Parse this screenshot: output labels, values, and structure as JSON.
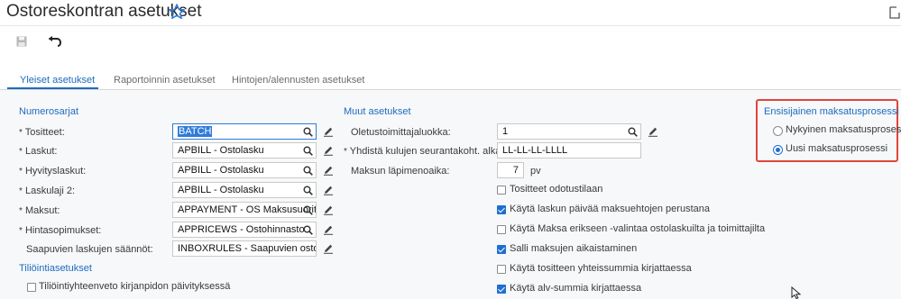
{
  "header": {
    "title": "Ostoreskontran asetukset"
  },
  "tabs": [
    {
      "label": "Yleiset asetukset"
    },
    {
      "label": "Raportoinnin asetukset"
    },
    {
      "label": "Hintojen/alennusten asetukset"
    }
  ],
  "numerosarjat": {
    "heading": "Numerosarjat",
    "required_mark": "*",
    "rows": [
      {
        "label": "Tositteet:",
        "value_selected": "BATCH"
      },
      {
        "label": "Laskut:",
        "value": "APBILL - Ostolasku"
      },
      {
        "label": "Hyvityslaskut:",
        "value": "APBILL - Ostolasku"
      },
      {
        "label": "Laskulaji 2:",
        "value": "APBILL - Ostolasku"
      },
      {
        "label": "Maksut:",
        "value": "APPAYMENT - OS Maksusuoritu"
      },
      {
        "label": "Hintasopimukset:",
        "value": "APPRICEWS - Ostohinnasto"
      },
      {
        "label": "Saapuvien laskujen säännöt:",
        "value": "INBOXRULES - Saapuvien osto"
      }
    ]
  },
  "tiliointi": {
    "heading": "Tiliöintiasetukset",
    "checkbox_label": "Tiliöintiyhteenveto kirjanpidon päivityksessä",
    "checked": false
  },
  "muut": {
    "heading": "Muut asetukset",
    "oletustoimittaja_label": "Oletustoimittajaluokka:",
    "oletustoimittaja_value": "1",
    "kulujen_label": "Yhdistä kulujen seurantakoht. alkaen:",
    "kulujen_value": "LL-LL-LL-LLLL",
    "lapimeno_label": "Maksun läpimenoaika:",
    "lapimeno_value": "7",
    "lapimeno_unit": "pv",
    "checkboxes": [
      {
        "label": "Tositteet odotustilaan",
        "checked": false
      },
      {
        "label": "Käytä laskun päivää maksuehtojen perustana",
        "checked": true
      },
      {
        "label": "Käytä Maksa erikseen -valintaa ostolaskuilta ja toimittajilta",
        "checked": false
      },
      {
        "label": "Salli maksujen aikaistaminen",
        "checked": true
      },
      {
        "label": "Käytä tositteen yhteissummia kirjattaessa",
        "checked": false
      },
      {
        "label": "Käytä alv-summia kirjattaessa",
        "checked": true
      }
    ]
  },
  "maksatusprosessi": {
    "heading": "Ensisijainen maksatusprosessi",
    "options": [
      {
        "label": "Nykyinen maksatusprosessi",
        "selected": false
      },
      {
        "label": "Uusi maksatusprosessi",
        "selected": true
      }
    ],
    "highlight_color": "#e0453a"
  },
  "colors": {
    "accent": "#1d6cbf",
    "checkbox": "#1f6fd1"
  }
}
